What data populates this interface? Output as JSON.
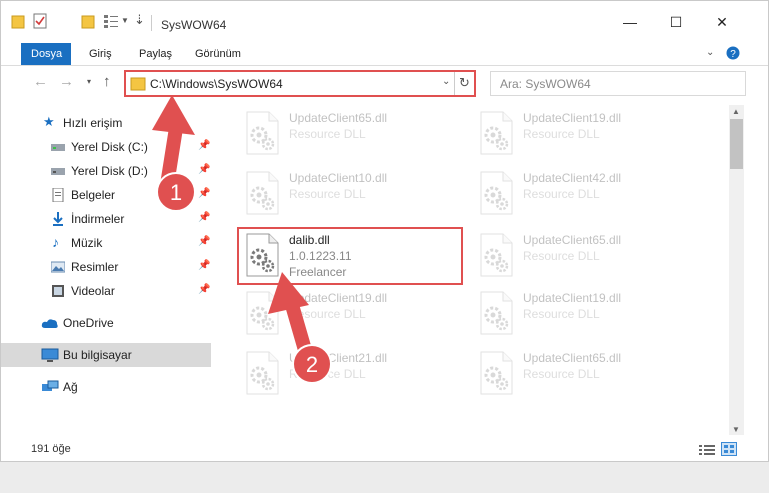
{
  "window": {
    "title": "SysWOW64",
    "minimize": "—",
    "maximize": "☐",
    "close": "✕"
  },
  "tabs": [
    {
      "label": "Dosya"
    },
    {
      "label": "Giriş"
    },
    {
      "label": "Paylaş"
    },
    {
      "label": "Görünüm"
    }
  ],
  "address": {
    "path": "C:\\Windows\\SysWOW64",
    "search_placeholder": "Ara: SysWOW64"
  },
  "sidebar": {
    "quick_access": "Hızlı erişim",
    "items": [
      {
        "label": "Yerel Disk (C:)"
      },
      {
        "label": "Yerel Disk (D:)"
      },
      {
        "label": "Belgeler"
      },
      {
        "label": "İndirmeler"
      },
      {
        "label": "Müzik"
      },
      {
        "label": "Resimler"
      },
      {
        "label": "Videolar"
      }
    ],
    "onedrive": "OneDrive",
    "this_pc": "Bu bilgisayar",
    "network": "Ağ"
  },
  "files": {
    "left": [
      {
        "name": "UpdateClient65.dll",
        "type": "Resource DLL"
      },
      {
        "name": "UpdateClient10.dll",
        "type": "Resource DLL"
      },
      {
        "name": "dalib.dll",
        "version": "1.0.1223.11",
        "company": "Freelancer"
      },
      {
        "name": "UpdateClient19.dll",
        "type": "Resource DLL"
      },
      {
        "name": "UpdateClient21.dll",
        "type": "Resource DLL"
      }
    ],
    "right": [
      {
        "name": "UpdateClient19.dll",
        "type": "Resource DLL"
      },
      {
        "name": "UpdateClient42.dll",
        "type": "Resource DLL"
      },
      {
        "name": "UpdateClient65.dll",
        "type": "Resource DLL"
      },
      {
        "name": "UpdateClient19.dll",
        "type": "Resource DLL"
      },
      {
        "name": "UpdateClient65.dll",
        "type": "Resource DLL"
      }
    ]
  },
  "status": {
    "count": "191 öğe"
  },
  "annotations": {
    "step1": "1",
    "step2": "2",
    "color": "#e05050"
  }
}
